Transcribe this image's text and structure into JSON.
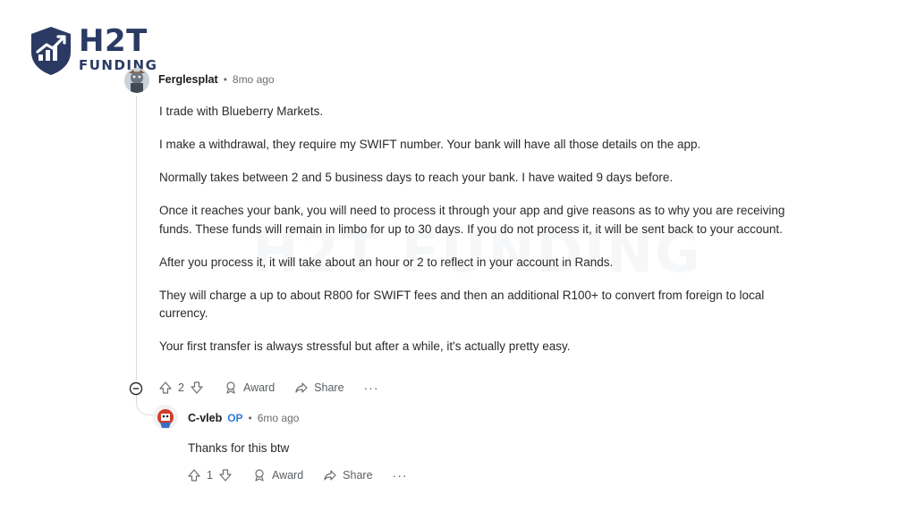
{
  "logo": {
    "brand": "H2T",
    "sub": "FUNDING"
  },
  "watermark": "H2T FUNDING",
  "comment": {
    "username": "Ferglesplat",
    "time": "8mo ago",
    "paragraphs": [
      "I trade with Blueberry Markets.",
      "I make a withdrawal, they require my SWIFT number. Your bank will have all those details on the app.",
      "Normally takes between 2 and 5 business days to reach your bank. I have waited 9 days before.",
      "Once it reaches your bank, you will need to process it through your app and give reasons as to why you are receiving funds. These funds will remain in limbo for up to 30 days. If you do not process it, it will be sent back to your account.",
      "After you process it, it will take about an hour or 2 to reflect in your account in Rands.",
      "They will charge a up to about R800 for SWIFT fees and then an additional R100+ to convert from foreign to local currency.",
      "Your first transfer is always stressful but after a while, it's actually pretty easy."
    ],
    "votes": "2",
    "award_label": "Award",
    "share_label": "Share",
    "more_label": "···"
  },
  "reply": {
    "username": "C-vleb",
    "op_badge": "OP",
    "time": "6mo ago",
    "text": "Thanks for this btw",
    "votes": "1",
    "award_label": "Award",
    "share_label": "Share",
    "more_label": "···"
  },
  "colors": {
    "logo": "#2b3a63",
    "op": "#2f7ad8",
    "text": "#2a2a2a",
    "muted": "#6a6e72"
  }
}
